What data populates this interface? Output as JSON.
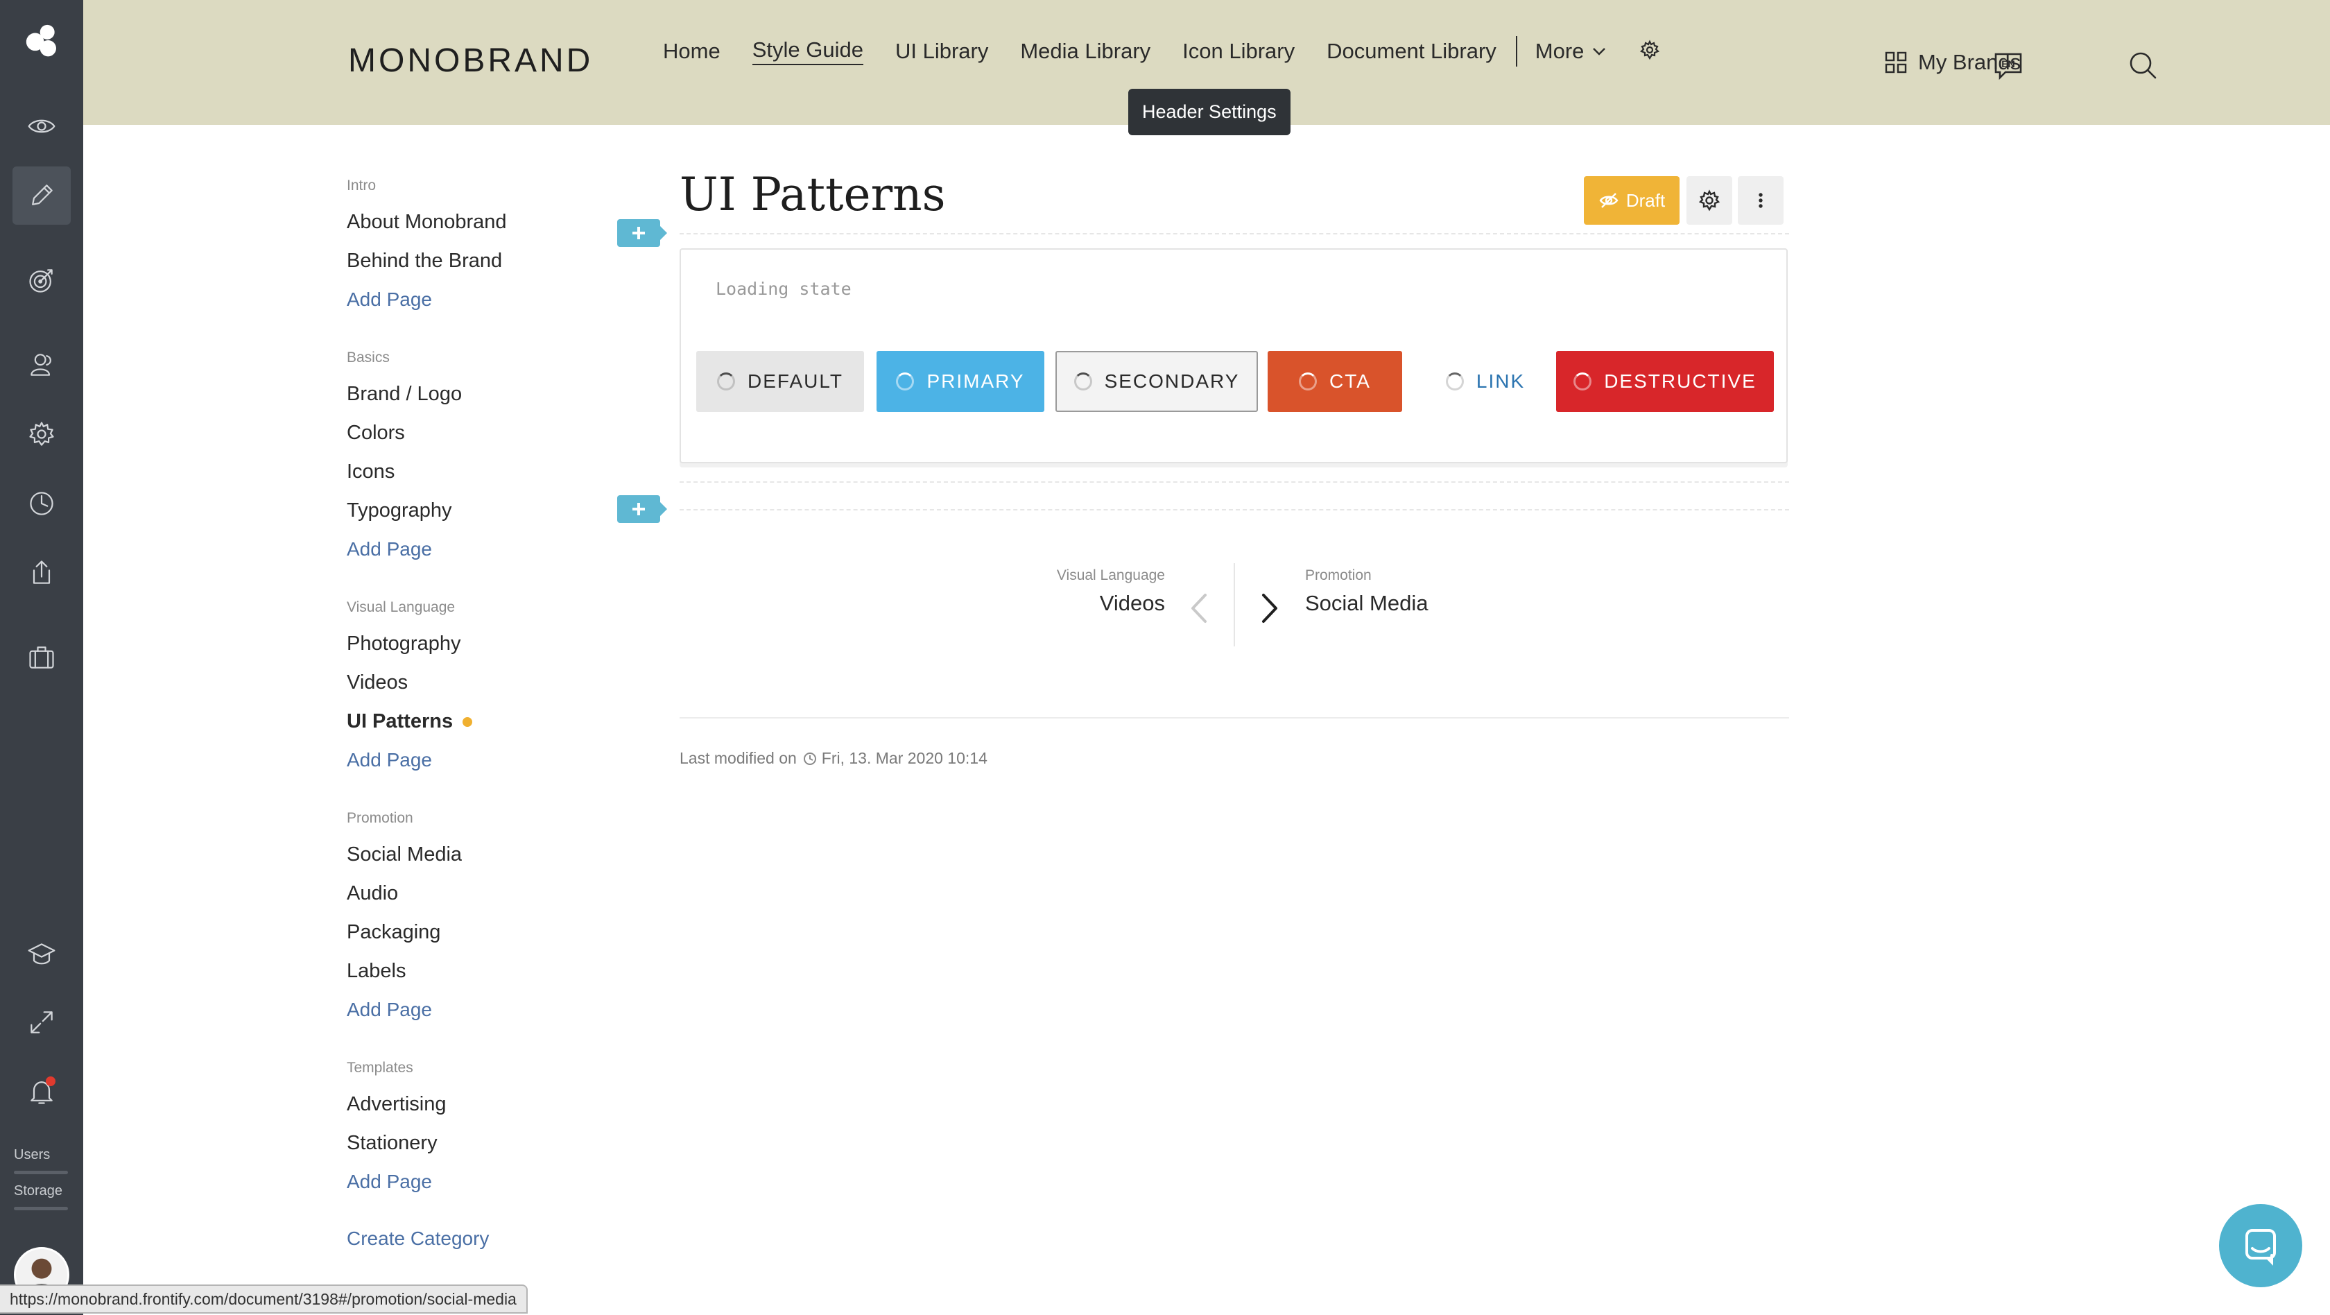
{
  "header": {
    "brand": "MONOBRAND",
    "nav": [
      "Home",
      "Style Guide",
      "UI Library",
      "Media Library",
      "Icon Library",
      "Document Library"
    ],
    "more": "More",
    "tooltip": "Header Settings",
    "my_brands": "My Brands",
    "lang_badge": "EN",
    "bg_color": "#dcdac1"
  },
  "rail": {
    "icons": [
      "frontify-logo-icon",
      "eye-icon",
      "pencil-icon",
      "target-icon",
      "users-icon",
      "gear-icon",
      "clock-icon",
      "share-icon",
      "briefcase-icon",
      "graduation-cap-icon",
      "expand-icon",
      "bell-icon"
    ],
    "users_label": "Users",
    "storage_label": "Storage"
  },
  "sidebar": {
    "groups": [
      {
        "category": "Intro",
        "items": [
          "About Monobrand",
          "Behind the Brand"
        ],
        "add": "Add Page"
      },
      {
        "category": "Basics",
        "items": [
          "Brand / Logo",
          "Colors",
          "Icons",
          "Typography"
        ],
        "add": "Add Page"
      },
      {
        "category": "Visual Language",
        "items": [
          "Photography",
          "Videos",
          "UI Patterns"
        ],
        "add": "Add Page"
      },
      {
        "category": "Promotion",
        "items": [
          "Social Media",
          "Audio",
          "Packaging",
          "Labels"
        ],
        "add": "Add Page"
      },
      {
        "category": "Templates",
        "items": [
          "Advertising",
          "Stationery"
        ],
        "add": "Add Page"
      }
    ],
    "create_category": "Create Category"
  },
  "page": {
    "title": "UI Patterns",
    "draft_label": "Draft",
    "block_title": "Loading state",
    "buttons": {
      "default": "DEFAULT",
      "primary": "PRIMARY",
      "secondary": "SECONDARY",
      "cta": "CTA",
      "link": "LINK",
      "destructive": "DESTRUCTIVE"
    },
    "prev": {
      "category": "Visual Language",
      "page": "Videos"
    },
    "next": {
      "category": "Promotion",
      "page": "Social Media"
    },
    "last_modified_label": "Last modified on",
    "last_modified_date": "Fri, 13. Mar 2020 10:14"
  },
  "status_url": "https://monobrand.frontify.com/document/3198#/promotion/social-media",
  "colors": {
    "accent_blue": "#4cb3e6",
    "cta": "#d9532b",
    "destructive": "#d8262a",
    "draft": "#f0b437",
    "add_block": "#5fb8d3"
  }
}
